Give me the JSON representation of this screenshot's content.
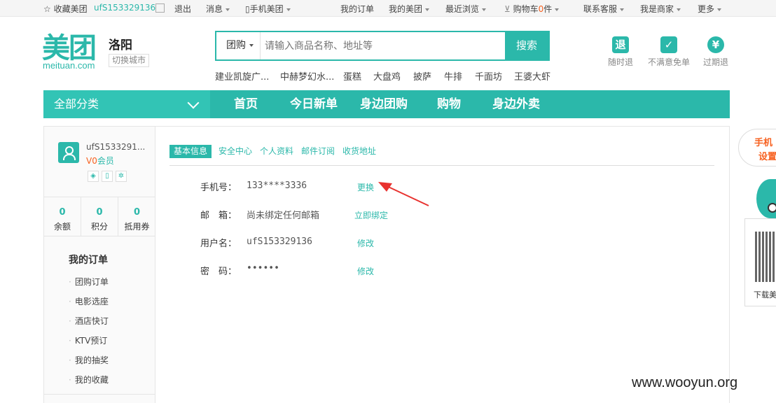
{
  "topbar": {
    "favorite": "☆ 收藏美团",
    "username": "ufS153329136",
    "logout": "退出",
    "message": "消息",
    "mobile": "手机美团",
    "my_orders": "我的订单",
    "my_meituan": "我的美团",
    "recent": "最近浏览",
    "cart_prefix": "购物车",
    "cart_count": "0",
    "cart_suffix": "件",
    "service": "联系客服",
    "merchant": "我是商家",
    "more": "更多"
  },
  "header": {
    "logo_cn": "美团",
    "logo_en": "meituan.com",
    "city": "洛阳",
    "switch_city": "切换城市"
  },
  "search": {
    "category": "团购",
    "placeholder": "请输入商品名称、地址等",
    "button": "搜索",
    "hotwords": [
      "建业凯旋广...",
      "中赫梦幻水...",
      "蛋糕",
      "大盘鸡",
      "披萨",
      "牛排",
      "千面坊",
      "王婆大虾"
    ]
  },
  "promises": [
    {
      "icon": "退",
      "label": "随时退"
    },
    {
      "icon": "✓",
      "label": "不满意免单"
    },
    {
      "icon": "¥",
      "label": "过期退"
    }
  ],
  "nav": {
    "all": "全部分类",
    "items": [
      "首页",
      "今日新单",
      "身边团购",
      "购物",
      "身边外卖"
    ]
  },
  "sidebar": {
    "username": "ufS1533291...",
    "level_v": "V0",
    "level_text": "会员",
    "stats": [
      {
        "value": "0",
        "label": "余额"
      },
      {
        "value": "0",
        "label": "积分"
      },
      {
        "value": "0",
        "label": "抵用券"
      }
    ],
    "menu_title": "我的订单",
    "menu_items": [
      "团购订单",
      "电影选座",
      "酒店快订",
      "KTV预订",
      "我的抽奖",
      "我的收藏"
    ]
  },
  "main": {
    "tabs": [
      "基本信息",
      "安全中心",
      "个人资料",
      "邮件订阅",
      "收货地址"
    ],
    "rows": [
      {
        "label": "手机号：",
        "value": "133****3336",
        "link": "更换"
      },
      {
        "label": "邮　箱：",
        "value": "尚未绑定任何邮箱",
        "link": "立即绑定"
      },
      {
        "label": "用户名：",
        "value": "ufS153329136",
        "link": "修改"
      },
      {
        "label": "密　码：",
        "value": "••••••",
        "link": "修改"
      }
    ]
  },
  "float": {
    "bubble_line1": "手机",
    "bubble_line2": "设置",
    "qr_text": "下载美"
  },
  "watermark": "www.wooyun.org",
  "colors": {
    "accent": "#2bb8aa",
    "orange": "#f76120",
    "arrow": "#e8322f"
  }
}
